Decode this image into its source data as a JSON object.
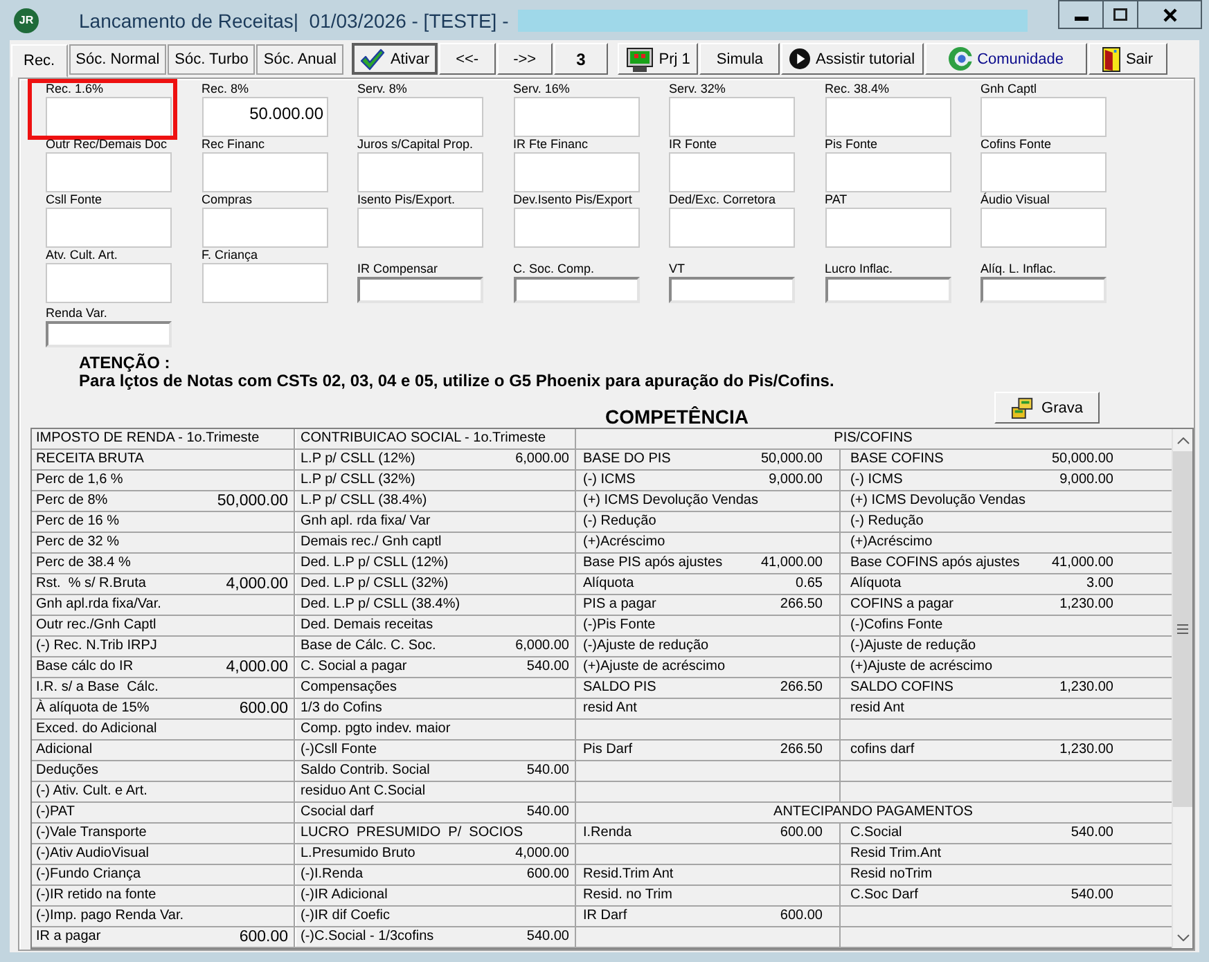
{
  "window": {
    "logo_text": "JR",
    "title": "Lancamento de Receitas|  01/03/2026 - [TESTE] -"
  },
  "tabs": [
    {
      "label": "Rec.",
      "selected": true
    },
    {
      "label": "Sóc. Normal",
      "selected": false
    },
    {
      "label": "Sóc. Turbo",
      "selected": false
    },
    {
      "label": "Sóc. Anual",
      "selected": false
    }
  ],
  "toolbar": [
    {
      "kind": "check",
      "label": "Ativar",
      "focused": true
    },
    {
      "kind": "text",
      "label": "<<-",
      "focused": false
    },
    {
      "kind": "text",
      "label": "->>",
      "focused": false
    },
    {
      "kind": "counter",
      "label": "3",
      "focused": false
    },
    {
      "kind": "monitor",
      "label": "Prj 1",
      "focused": false
    },
    {
      "kind": "text",
      "label": "Simula",
      "focused": false
    },
    {
      "kind": "play",
      "label": "Assistir tutorial",
      "focused": false
    },
    {
      "kind": "community",
      "label": "Comunidade",
      "focused": false
    },
    {
      "kind": "door",
      "label": "Sair",
      "focused": false
    }
  ],
  "fields": [
    [
      {
        "label": "Rec. 1.6%",
        "kind": "tall",
        "highlighted": true
      },
      {
        "label": "Rec. 8%",
        "kind": "tall",
        "value": "50.000.00",
        "highlighted": false
      },
      {
        "label": "Serv. 8%",
        "kind": "tall",
        "highlighted": false
      },
      {
        "label": "Serv. 16%",
        "kind": "tall",
        "highlighted": false
      },
      {
        "label": "Serv. 32%",
        "kind": "tall",
        "highlighted": false
      },
      {
        "label": "Rec. 38.4%",
        "kind": "tall",
        "highlighted": false
      },
      {
        "label": "Gnh Captl",
        "kind": "tall",
        "highlighted": false
      }
    ],
    [
      {
        "label": "Outr Rec/Demais Doc",
        "kind": "tall",
        "highlighted": false
      },
      {
        "label": "Rec Financ",
        "kind": "tall",
        "highlighted": false
      },
      {
        "label": "Juros s/Capital Prop.",
        "kind": "tall",
        "highlighted": false
      },
      {
        "label": "IR Fte Financ",
        "kind": "tall",
        "highlighted": false
      },
      {
        "label": "IR Fonte",
        "kind": "tall",
        "highlighted": false
      },
      {
        "label": "Pis Fonte",
        "kind": "tall",
        "highlighted": false
      },
      {
        "label": "Cofins Fonte",
        "kind": "tall",
        "highlighted": false
      }
    ],
    [
      {
        "label": "Csll Fonte",
        "kind": "tall",
        "highlighted": false
      },
      {
        "label": "Compras",
        "kind": "tall",
        "highlighted": false
      },
      {
        "label": "Isento Pis/Export.",
        "kind": "tall",
        "highlighted": false
      },
      {
        "label": "Dev.Isento Pis/Export",
        "kind": "tall",
        "highlighted": false
      },
      {
        "label": "Ded/Exc. Corretora",
        "kind": "tall",
        "highlighted": false
      },
      {
        "label": "PAT",
        "kind": "tall",
        "highlighted": false
      },
      {
        "label": "Áudio Visual",
        "kind": "tall",
        "highlighted": false
      }
    ],
    [
      {
        "label": "Atv. Cult. Art.",
        "kind": "tall",
        "highlighted": false
      },
      {
        "label": "F. Criança",
        "kind": "tall",
        "highlighted": false
      },
      {
        "label": "IR Compensar",
        "kind": "short",
        "highlighted": false
      },
      {
        "label": "C. Soc. Comp.",
        "kind": "short",
        "highlighted": false
      },
      {
        "label": "VT",
        "kind": "short",
        "highlighted": false
      },
      {
        "label": "Lucro Inflac.",
        "kind": "short",
        "highlighted": false
      },
      {
        "label": "Alíq. L. Inflac.",
        "kind": "short",
        "highlighted": false
      }
    ],
    [
      {
        "label": "Renda Var.",
        "kind": "short",
        "highlighted": false
      }
    ]
  ],
  "notice": {
    "title": "ATENÇÃO :",
    "text": "Para lçtos de Notas com CSTs 02, 03, 04 e 05, utilize o G5 Phoenix para apuração do Pis/Cofins."
  },
  "section_title": "COMPETÊNCIA",
  "save_button": {
    "label": "Grava"
  },
  "grid": {
    "income_tax": {
      "title": "IMPOSTO DE RENDA - 1o.Trimeste",
      "rows": [
        {
          "label": "RECEITA BRUTA"
        },
        {
          "label": "Perc de 1,6 %"
        },
        {
          "label": "Perc de 8%",
          "value": "50,000.00"
        },
        {
          "label": "Perc de 16 %"
        },
        {
          "label": "Perc de 32 %"
        },
        {
          "label": "Perc de 38.4 %"
        },
        {
          "label": "Rst.  % s/ R.Bruta",
          "value": "4,000.00"
        },
        {
          "label": "Gnh apl.rda fixa/Var."
        },
        {
          "label": "Outr rec./Gnh Captl"
        },
        {
          "label": "(-) Rec. N.Trib IRPJ"
        },
        {
          "label": "Base cálc do IR",
          "value": "4,000.00"
        },
        {
          "label": "I.R. s/ a Base  Cálc."
        },
        {
          "label": "À alíquota de 15%",
          "value": "600.00"
        },
        {
          "label": "Exced. do Adicional"
        },
        {
          "label": "Adicional"
        },
        {
          "label": "Deduções"
        },
        {
          "label": "(-) Ativ. Cult. e Art."
        },
        {
          "label": "(-)PAT"
        },
        {
          "label": "(-)Vale Transporte"
        },
        {
          "label": "(-)Ativ AudioVisual"
        },
        {
          "label": "(-)Fundo Criança"
        },
        {
          "label": "(-)IR retido na fonte"
        },
        {
          "label": "(-)Imp. pago Renda Var."
        },
        {
          "label": "IR a pagar",
          "value": "600.00"
        }
      ]
    },
    "social_contribution": {
      "title": "CONTRIBUICAO SOCIAL - 1o.Trimeste",
      "rows": [
        {
          "label": "L.P p/ CSLL (12%)",
          "value": "6,000.00"
        },
        {
          "label": "L.P p/ CSLL (32%)"
        },
        {
          "label": "L.P p/ CSLL (38.4%)"
        },
        {
          "label": "Gnh apl. rda fixa/ Var"
        },
        {
          "label": "Demais rec./ Gnh captl"
        },
        {
          "label": "Ded. L.P p/ CSLL (12%)"
        },
        {
          "label": "Ded. L.P p/ CSLL (32%)"
        },
        {
          "label": "Ded. L.P p/ CSLL (38.4%)"
        },
        {
          "label": "Ded. Demais receitas"
        },
        {
          "label": "Base de Cálc. C. Soc.",
          "value": "6,000.00"
        },
        {
          "label": "C. Social a pagar",
          "value": "540.00"
        },
        {
          "label": "Compensações"
        },
        {
          "label": "1/3 do Cofins"
        },
        {
          "label": "Comp. pgto indev. maior"
        },
        {
          "label": "(-)Csll Fonte"
        },
        {
          "label": "Saldo Contrib. Social",
          "value": "540.00"
        },
        {
          "label": "residuo Ant C.Social"
        },
        {
          "label": "Csocial darf",
          "value": "540.00"
        },
        {
          "label": "LUCRO  PRESUMIDO  P/  SOCIOS"
        },
        {
          "label": "L.Presumido Bruto",
          "value": "4,000.00"
        },
        {
          "label": "(-)I.Renda",
          "value": "600.00"
        },
        {
          "label": "(-)IR Adicional"
        },
        {
          "label": "(-)IR dif Coefic"
        },
        {
          "label": "(-)C.Social - 1/3cofins",
          "value": "540.00"
        }
      ]
    },
    "pis_cofins": {
      "title": "PIS/COFINS",
      "rows": [
        {
          "pis": {
            "label": "BASE DO PIS",
            "value": "50,000.00"
          },
          "cofins": {
            "label": "BASE COFINS",
            "value": "50,000.00"
          }
        },
        {
          "pis": {
            "label": "(-) ICMS",
            "value": "9,000.00"
          },
          "cofins": {
            "label": "(-) ICMS",
            "value": "9,000.00"
          }
        },
        {
          "pis": {
            "label": "(+) ICMS Devolução Vendas"
          },
          "cofins": {
            "label": "(+) ICMS Devolução Vendas"
          }
        },
        {
          "pis": {
            "label": "(-) Redução"
          },
          "cofins": {
            "label": "(-) Redução"
          }
        },
        {
          "pis": {
            "label": "(+)Acréscimo"
          },
          "cofins": {
            "label": "(+)Acréscimo"
          }
        },
        {
          "pis": {
            "label": "Base PIS após ajustes",
            "value": "41,000.00"
          },
          "cofins": {
            "label": "Base COFINS após ajustes",
            "value": "41,000.00"
          }
        },
        {
          "pis": {
            "label": "Alíquota",
            "value": "0.65"
          },
          "cofins": {
            "label": "Alíquota",
            "value": "3.00"
          }
        },
        {
          "pis": {
            "label": "PIS a pagar",
            "value": "266.50"
          },
          "cofins": {
            "label": "COFINS a pagar",
            "value": "1,230.00"
          }
        },
        {
          "pis": {
            "label": "(-)Pis Fonte"
          },
          "cofins": {
            "label": "(-)Cofins Fonte"
          }
        },
        {
          "pis": {
            "label": "(-)Ajuste de redução"
          },
          "cofins": {
            "label": "(-)Ajuste de redução"
          }
        },
        {
          "pis": {
            "label": "(+)Ajuste de acréscimo"
          },
          "cofins": {
            "label": "(+)Ajuste de acréscimo"
          }
        },
        {
          "pis": {
            "label": "SALDO PIS",
            "value": "266.50"
          },
          "cofins": {
            "label": "SALDO COFINS",
            "value": "1,230.00"
          }
        },
        {
          "pis": {
            "label": "resid Ant"
          },
          "cofins": {
            "label": "resid Ant"
          }
        },
        {},
        {
          "pis": {
            "label": "Pis Darf",
            "value": "266.50"
          },
          "cofins": {
            "label": "cofins darf",
            "value": "1,230.00"
          }
        },
        {},
        {}
      ]
    },
    "advance_payments": {
      "title": "ANTECIPANDO PAGAMENTOS",
      "rows": [
        {
          "income_tax": {
            "label": "I.Renda",
            "value": "600.00"
          },
          "social_contribution": {
            "label": "C.Social",
            "value": "540.00"
          }
        },
        {
          "social_contribution": {
            "label": "Resid Trim.Ant"
          }
        },
        {
          "income_tax": {
            "label": "Resid.Trim Ant"
          },
          "social_contribution": {
            "label": "Resid noTrim"
          }
        },
        {
          "income_tax": {
            "label": "Resid. no Trim"
          },
          "social_contribution": {
            "label": "C.Soc Darf",
            "value": "540.00"
          }
        },
        {
          "income_tax": {
            "label": "IR Darf",
            "value": "600.00"
          }
        },
        {}
      ]
    }
  }
}
